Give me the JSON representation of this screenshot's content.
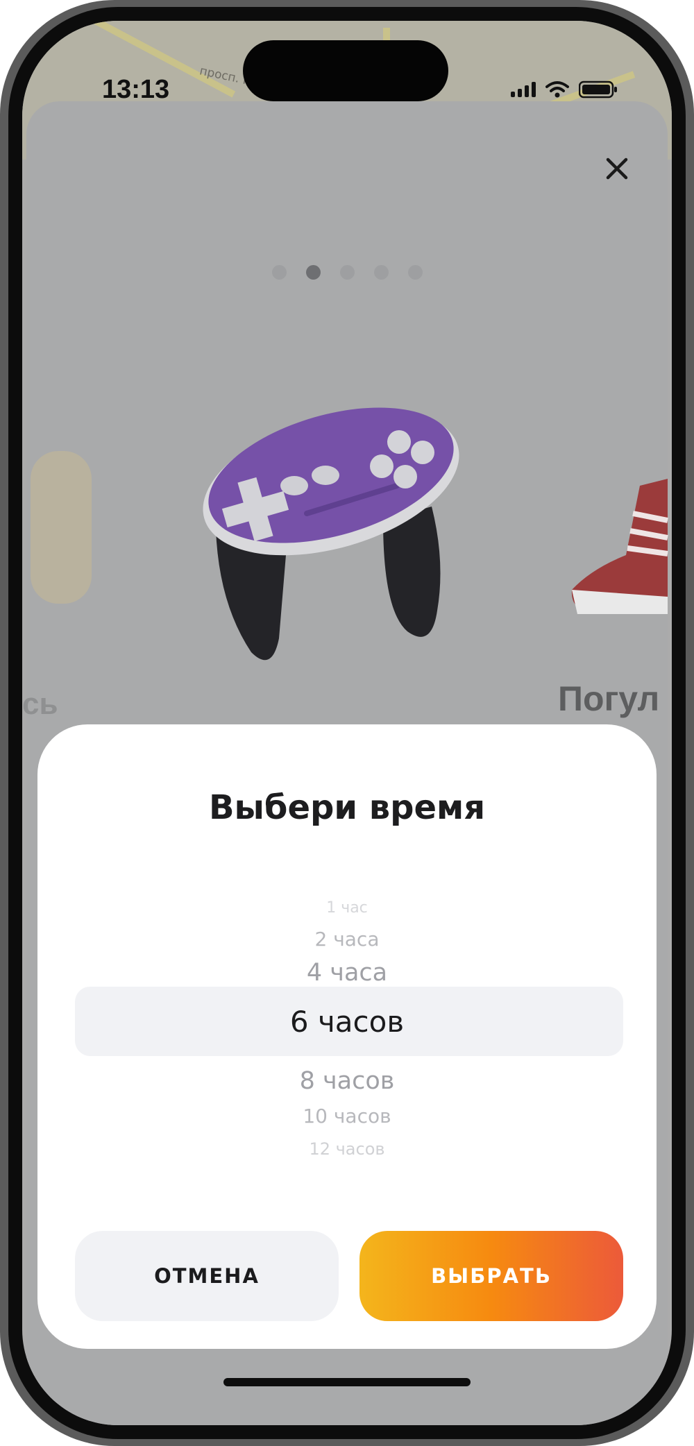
{
  "status_bar": {
    "time": "13:13",
    "map_label": "просп. П"
  },
  "carousel": {
    "current_index": 2,
    "total": 5,
    "left_item_partial": "сь",
    "right_item_partial": "Погул",
    "center_icon": "gamepad-icon"
  },
  "time_picker": {
    "title": "Выбери время",
    "options": [
      "1 час",
      "2 часа",
      "4 часа",
      "6 часов",
      "8 часов",
      "10 часов",
      "12 часов"
    ],
    "selected": "6 часов"
  },
  "buttons": {
    "cancel": "ОТМЕНА",
    "select": "ВЫБРАТЬ"
  },
  "colors": {
    "accent_start": "#f4b51c",
    "accent_mid": "#f68a10",
    "accent_end": "#ec5a3a",
    "gamepad": "#7651a8"
  }
}
